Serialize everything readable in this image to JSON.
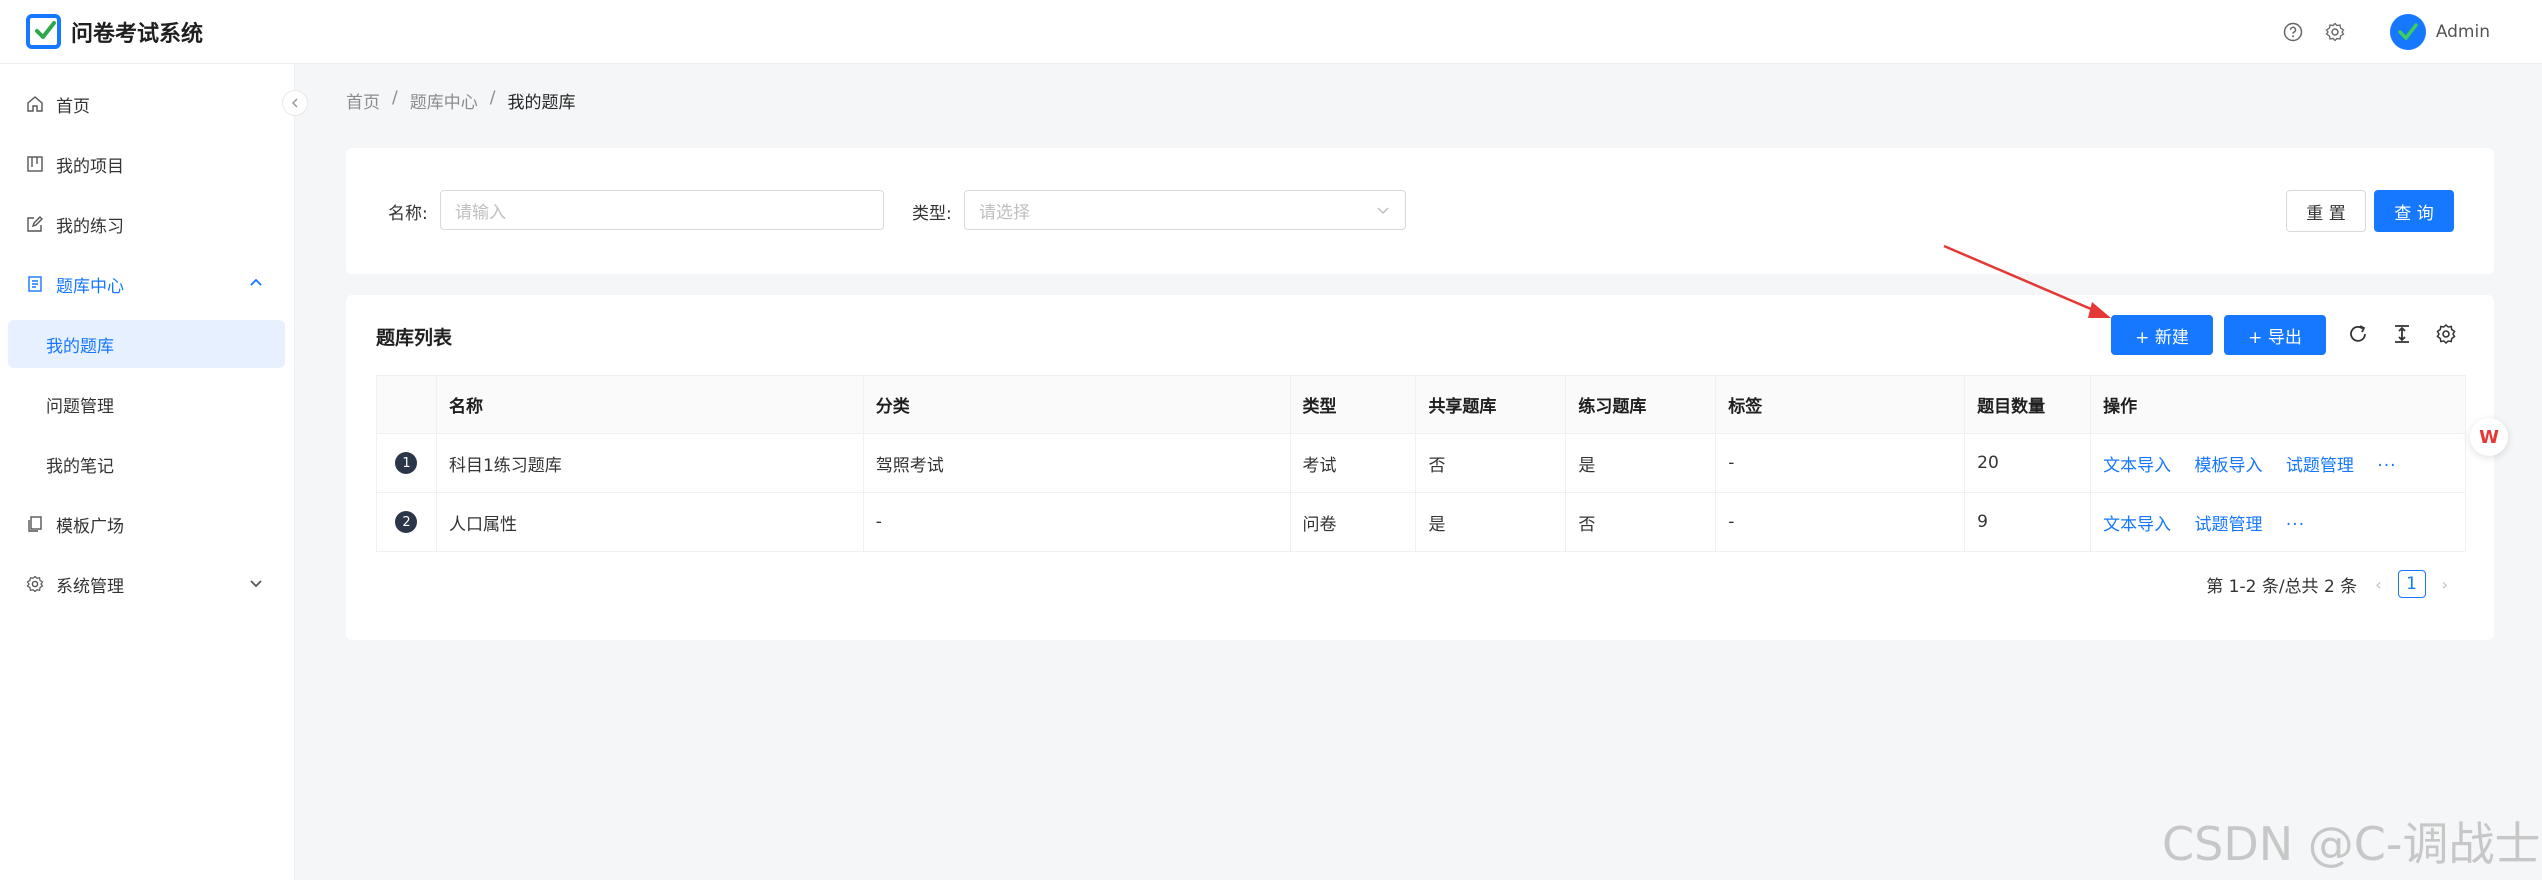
{
  "app": {
    "title": "问卷考试系统",
    "user": "Admin"
  },
  "sidebar": {
    "items": [
      {
        "label": "首页",
        "icon": "home-icon"
      },
      {
        "label": "我的项目",
        "icon": "project-icon"
      },
      {
        "label": "我的练习",
        "icon": "edit-icon"
      },
      {
        "label": "题库中心",
        "icon": "book-icon"
      },
      {
        "label": "我的题库"
      },
      {
        "label": "问题管理"
      },
      {
        "label": "我的笔记"
      },
      {
        "label": "模板广场",
        "icon": "copy-icon"
      },
      {
        "label": "系统管理",
        "icon": "gear-icon"
      }
    ]
  },
  "breadcrumb": [
    "首页",
    "题库中心",
    "我的题库"
  ],
  "filter": {
    "name_label": "名称:",
    "name_placeholder": "请输入",
    "type_label": "类型:",
    "type_placeholder": "请选择",
    "reset": "重 置",
    "search": "查 询"
  },
  "list": {
    "title": "题库列表",
    "new_btn": "+ 新建",
    "export_btn": "+ 导出",
    "columns": [
      "名称",
      "分类",
      "类型",
      "共享题库",
      "练习题库",
      "标签",
      "题目数量",
      "操作"
    ],
    "rows": [
      {
        "idx": "1",
        "name": "科目1练习题库",
        "category": "驾照考试",
        "type": "考试",
        "shared": "否",
        "practice": "是",
        "tag": "-",
        "count": "20",
        "ops": [
          "文本导入",
          "模板导入",
          "试题管理"
        ],
        "more": "···"
      },
      {
        "idx": "2",
        "name": "人口属性",
        "category": "-",
        "type": "问卷",
        "shared": "是",
        "practice": "否",
        "tag": "-",
        "count": "9",
        "ops": [
          "文本导入",
          "试题管理"
        ],
        "more": "···"
      }
    ]
  },
  "pager": {
    "summary": "第 1-2 条/总共 2 条",
    "current": "1"
  },
  "colors": {
    "primary": "#1677ff",
    "annotation_arrow": "#e53935"
  },
  "watermark": "CSDN @C-调战士",
  "wps_badge": "W"
}
